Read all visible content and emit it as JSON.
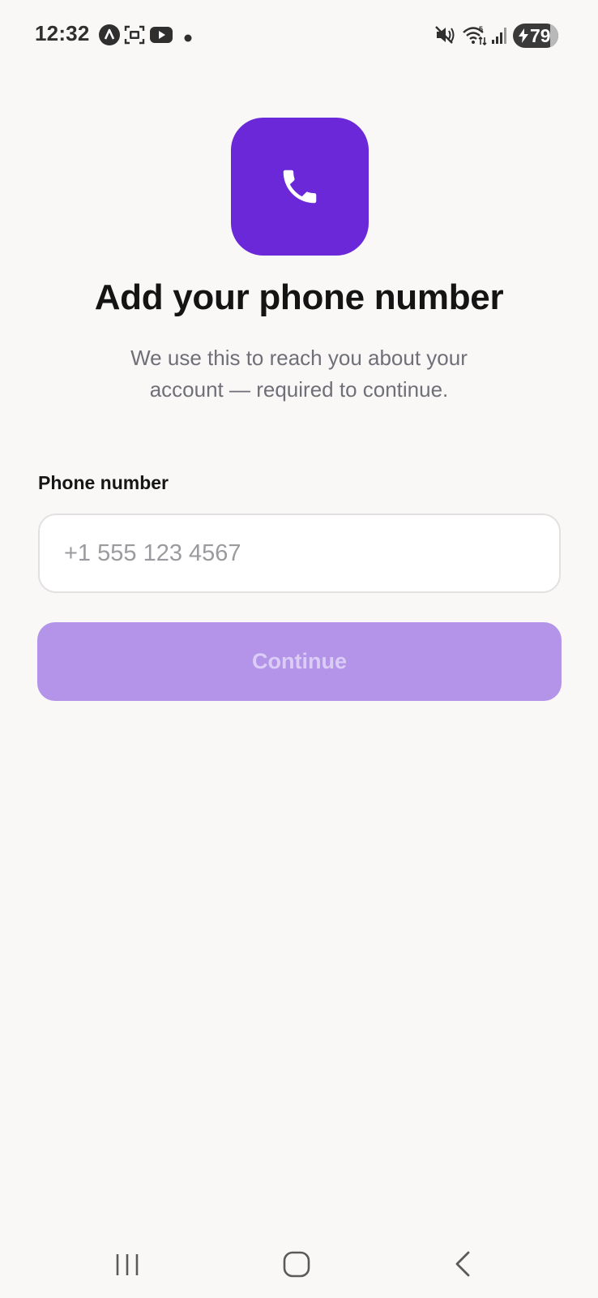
{
  "status_bar": {
    "time": "12:32",
    "battery_level": "79",
    "icons": [
      "accessibility-a-icon",
      "screenshot-icon",
      "youtube-icon",
      "notification-dot-icon",
      "mute-icon",
      "wifi-5g-icon",
      "signal-icon",
      "battery-charging-icon"
    ]
  },
  "app_icon": {
    "name": "phone-icon",
    "background": "#6b28d9"
  },
  "content": {
    "title": "Add your phone number",
    "subtitle": "We use this to reach you about your account — required to continue.",
    "field_label": "Phone number",
    "phone_placeholder": "+1 555 123 4567",
    "phone_value": "",
    "continue_label": "Continue"
  },
  "nav_bar": {
    "icons": [
      "recent-apps-icon",
      "home-icon",
      "back-icon"
    ]
  },
  "colors": {
    "background": "#faf8f7",
    "accent": "#6b28d9",
    "button_disabled": "#b394e9",
    "button_text_disabled": "#dccdf7"
  }
}
